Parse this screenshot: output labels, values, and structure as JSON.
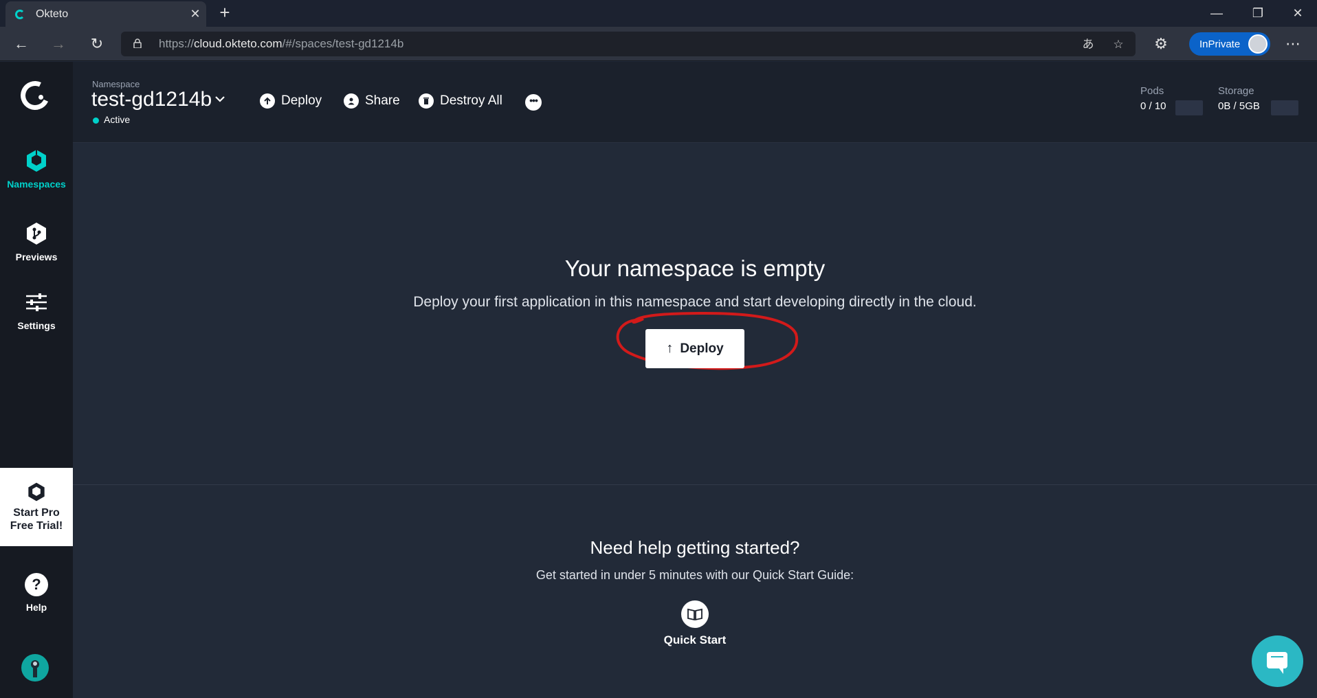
{
  "browser": {
    "tab_title": "Okteto",
    "url_prefix": "https://",
    "url_domain": "cloud.okteto.com",
    "url_path": "/#/spaces/test-gd1214b",
    "inprivate_label": "InPrivate"
  },
  "sidebar": {
    "items": [
      {
        "label": "Namespaces",
        "icon": "namespaces-icon",
        "active": true
      },
      {
        "label": "Previews",
        "icon": "previews-icon",
        "active": false
      },
      {
        "label": "Settings",
        "icon": "settings-icon",
        "active": false
      }
    ],
    "pro_trial": {
      "line1": "Start Pro",
      "line2": "Free Trial!"
    },
    "help_label": "Help"
  },
  "header": {
    "namespace_caption": "Namespace",
    "namespace_name": "test-gd1214b",
    "status": "Active",
    "actions": {
      "deploy": "Deploy",
      "share": "Share",
      "destroy_all": "Destroy All"
    },
    "quotas": {
      "pods_label": "Pods",
      "pods_value": "0 / 10",
      "storage_label": "Storage",
      "storage_value": "0B / 5GB"
    }
  },
  "main": {
    "empty_title": "Your namespace is empty",
    "empty_description": "Deploy your first application in this namespace and start developing directly in the cloud.",
    "deploy_button": "Deploy",
    "help_title": "Need help getting started?",
    "help_description": "Get started in under 5 minutes with our Quick Start Guide:",
    "quick_start_label": "Quick Start"
  },
  "colors": {
    "accent": "#00d1ca",
    "background": "#222a38",
    "sidebar": "#161a22",
    "annotation": "#d21a1a"
  }
}
